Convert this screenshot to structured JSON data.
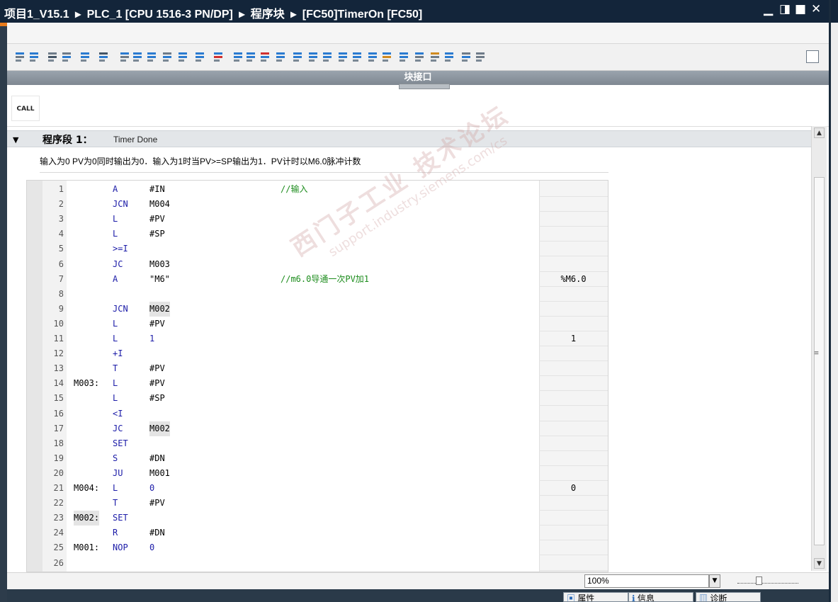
{
  "window": {
    "breadcrumb": [
      "项目1_V15.1",
      "PLC_1 [CPU 1516-3 PN/DP]",
      "程序块",
      "[FC50]TimerOn [FC50]"
    ],
    "separator": "▸",
    "controls": {
      "minimize": "▁",
      "restore": "◨",
      "maximize": "■",
      "close": "✕"
    }
  },
  "toolbar": {
    "icons": [
      "insert-network-icon",
      "delete-network-icon",
      "insert-row-icon",
      "delete-row-icon",
      "insert-block-icon",
      "open-all-networks-icon",
      "close-all-networks-icon",
      "absolute-operands-icon",
      "show-favorites-icon",
      "show-comments-icon",
      "monitoring-on-icon",
      "breakpoint-icon",
      "go-to-error-icon",
      "step-icon",
      "snapshot-icon",
      "compare-icon",
      "download-icon",
      "settings-icon"
    ]
  },
  "interface_bar": {
    "label": "块接口"
  },
  "palette": {
    "call_label": "CALL"
  },
  "network": {
    "label": "程序段 1：",
    "title": "Timer Done",
    "comment": "输入为0 PV为0同时输出为0．输入为1时当PV>=SP输出为1．PV计时以M6.0脉冲计数"
  },
  "code_lines": [
    {
      "num": "1",
      "label": "",
      "ins": "A",
      "op": "#IN",
      "cmt": "//输入",
      "mon": ""
    },
    {
      "num": "2",
      "label": "",
      "ins": "JCN",
      "op": "M004",
      "cmt": "",
      "mon": ""
    },
    {
      "num": "3",
      "label": "",
      "ins": "L",
      "op": "#PV",
      "cmt": "",
      "mon": ""
    },
    {
      "num": "4",
      "label": "",
      "ins": "L",
      "op": "#SP",
      "cmt": "",
      "mon": ""
    },
    {
      "num": "5",
      "label": "",
      "ins": ">=I",
      "op": "",
      "cmt": "",
      "mon": ""
    },
    {
      "num": "6",
      "label": "",
      "ins": "JC",
      "op": "M003",
      "cmt": "",
      "mon": ""
    },
    {
      "num": "7",
      "label": "",
      "ins": "A",
      "op": "\"M6\"",
      "cmt": "//m6.0导通一次PV加1",
      "mon": "%M6.0"
    },
    {
      "num": "8",
      "label": "",
      "ins": "",
      "op": "",
      "cmt": "",
      "mon": ""
    },
    {
      "num": "9",
      "label": "",
      "ins": "JCN",
      "op": "M002",
      "cmt": "",
      "mon": ""
    },
    {
      "num": "10",
      "label": "",
      "ins": "L",
      "op": "#PV",
      "cmt": "",
      "mon": ""
    },
    {
      "num": "11",
      "label": "",
      "ins": "L",
      "op": "1",
      "cmt": "",
      "mon": "1"
    },
    {
      "num": "12",
      "label": "",
      "ins": "+I",
      "op": "",
      "cmt": "",
      "mon": ""
    },
    {
      "num": "13",
      "label": "",
      "ins": "T",
      "op": "#PV",
      "cmt": "",
      "mon": ""
    },
    {
      "num": "14",
      "label": "M003:",
      "ins": "L",
      "op": "#PV",
      "cmt": "",
      "mon": ""
    },
    {
      "num": "15",
      "label": "",
      "ins": "L",
      "op": "#SP",
      "cmt": "",
      "mon": ""
    },
    {
      "num": "16",
      "label": "",
      "ins": "<I",
      "op": "",
      "cmt": "",
      "mon": ""
    },
    {
      "num": "17",
      "label": "",
      "ins": "JC",
      "op": "M002",
      "cmt": "",
      "mon": ""
    },
    {
      "num": "18",
      "label": "",
      "ins": "SET",
      "op": "",
      "cmt": "",
      "mon": ""
    },
    {
      "num": "19",
      "label": "",
      "ins": "S",
      "op": "#DN",
      "cmt": "",
      "mon": ""
    },
    {
      "num": "20",
      "label": "",
      "ins": "JU",
      "op": "M001",
      "cmt": "",
      "mon": ""
    },
    {
      "num": "21",
      "label": "M004:",
      "ins": "L",
      "op": "0",
      "cmt": "",
      "mon": "0"
    },
    {
      "num": "22",
      "label": "",
      "ins": "T",
      "op": "#PV",
      "cmt": "",
      "mon": ""
    },
    {
      "num": "23",
      "label": "M002:",
      "ins": "SET",
      "op": "",
      "cmt": "",
      "mon": ""
    },
    {
      "num": "24",
      "label": "",
      "ins": "R",
      "op": "#DN",
      "cmt": "",
      "mon": ""
    },
    {
      "num": "25",
      "label": "M001:",
      "ins": "NOP",
      "op": "0",
      "cmt": "",
      "mon": ""
    },
    {
      "num": "26",
      "label": "",
      "ins": "",
      "op": "",
      "cmt": "",
      "mon": ""
    }
  ],
  "zoom": {
    "value": "100%",
    "level_percent": 100
  },
  "inspector_tabs": [
    "属性",
    "信息",
    "诊断"
  ],
  "watermark": {
    "line1": "西门子工业 技术论坛",
    "line2": "support.industry.siemens.com/cs"
  }
}
